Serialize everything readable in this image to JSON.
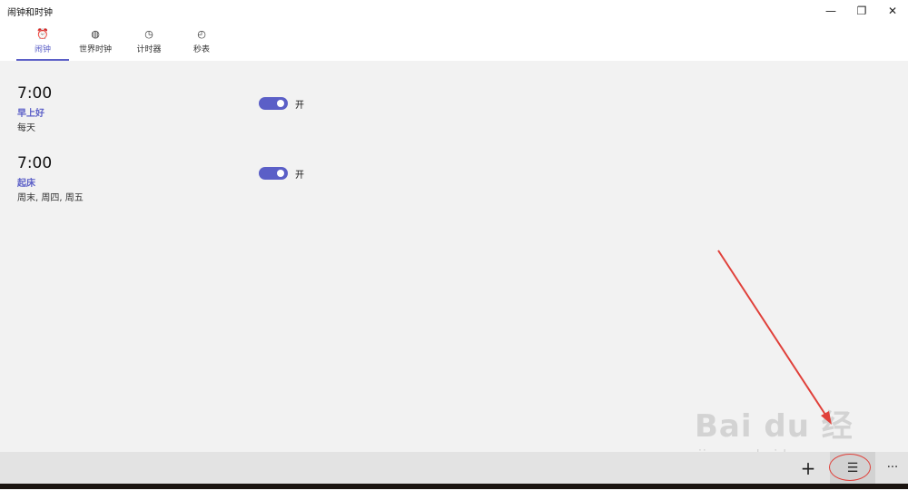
{
  "window": {
    "title": "闹钟和时钟",
    "minimize_glyph": "—",
    "restore_glyph": "❐",
    "close_glyph": "✕"
  },
  "tabs": [
    {
      "label": "闹钟",
      "icon": "alarm-icon",
      "glyph": "⏰",
      "active": true
    },
    {
      "label": "世界时钟",
      "icon": "globe-icon",
      "glyph": "◍",
      "active": false
    },
    {
      "label": "计时器",
      "icon": "timer-icon",
      "glyph": "◷",
      "active": false
    },
    {
      "label": "秒表",
      "icon": "stopwatch-icon",
      "glyph": "◴",
      "active": false
    }
  ],
  "alarms": [
    {
      "time": "7:00",
      "name": "早上好",
      "days": "每天",
      "enabled": true,
      "state_label": "开"
    },
    {
      "time": "7:00",
      "name": "起床",
      "days": "周末, 周四, 周五",
      "enabled": true,
      "state_label": "开"
    }
  ],
  "command_bar": {
    "add_glyph": "+",
    "select_glyph": "☰",
    "more_glyph": "···"
  },
  "watermark": {
    "logo_text": "Bai du 经验",
    "url": "jingyan.baidu.com"
  },
  "colors": {
    "accent": "#5b5fc7",
    "annotation": "#e0403a",
    "background": "#f2f2f2",
    "command_bar": "#e3e3e3"
  }
}
